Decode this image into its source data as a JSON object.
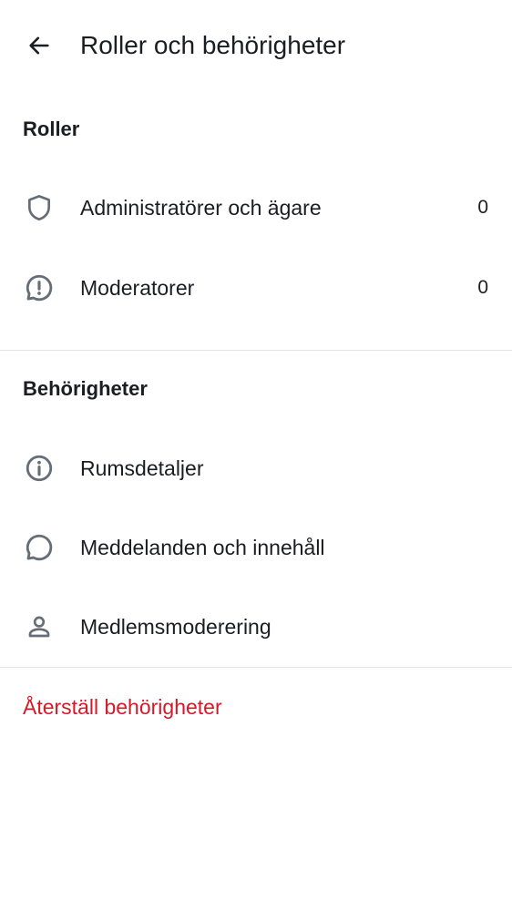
{
  "header": {
    "title": "Roller och behörigheter",
    "back_icon": "arrow-left-icon"
  },
  "roles": {
    "section_title": "Roller",
    "items": [
      {
        "label": "Administratörer och ägare",
        "count": "0",
        "icon": "shield-icon"
      },
      {
        "label": "Moderatorer",
        "count": "0",
        "icon": "chat-alert-icon"
      }
    ]
  },
  "permissions": {
    "section_title": "Behörigheter",
    "items": [
      {
        "label": "Rumsdetaljer",
        "icon": "info-icon"
      },
      {
        "label": "Meddelanden och innehåll",
        "icon": "chat-bubble-icon"
      },
      {
        "label": "Medlemsmoderering",
        "icon": "person-icon"
      }
    ]
  },
  "actions": {
    "reset_label": "Återställ behörigheter"
  },
  "colors": {
    "text": "#1b1d22",
    "icon": "#656d77",
    "divider": "#e3e5e8",
    "critical": "#d51928",
    "background": "#ffffff"
  }
}
